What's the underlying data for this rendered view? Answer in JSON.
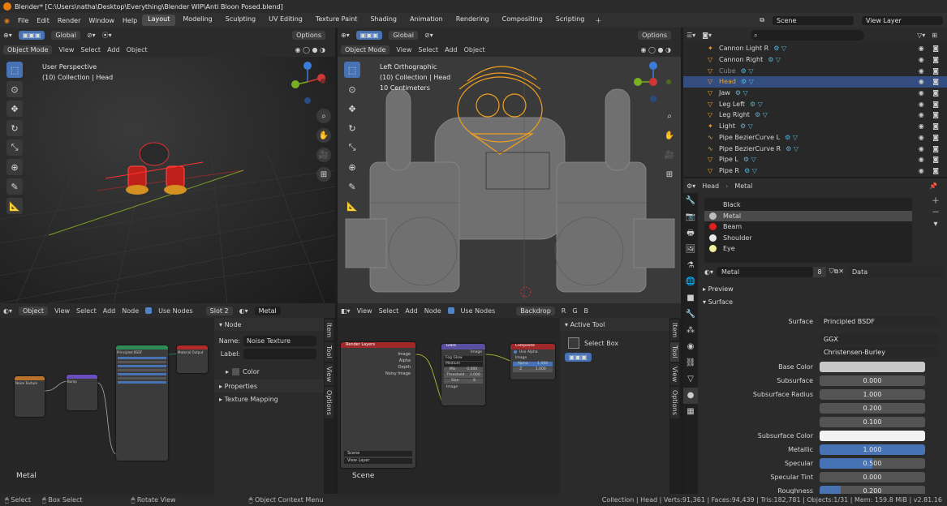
{
  "app": {
    "title": "Blender* [C:\\Users\\natha\\Desktop\\Everything\\Blender WIP\\Anti Bloon Posed.blend]"
  },
  "menu": [
    "File",
    "Edit",
    "Render",
    "Window",
    "Help"
  ],
  "workspaces": [
    "Layout",
    "Modeling",
    "Sculpting",
    "UV Editing",
    "Texture Paint",
    "Shading",
    "Animation",
    "Rendering",
    "Compositing",
    "Scripting"
  ],
  "scene": "Scene",
  "view_layer": "View Layer",
  "viewport_left": {
    "mode": "Object Mode",
    "menus": [
      "View",
      "Select",
      "Add",
      "Object"
    ],
    "orientation": "Global",
    "options": "Options",
    "overlay": [
      "User Perspective",
      "(10) Collection | Head"
    ]
  },
  "viewport_right": {
    "mode": "Object Mode",
    "menus": [
      "View",
      "Select",
      "Add",
      "Object"
    ],
    "orientation": "Global",
    "options": "Options",
    "overlay": [
      "Left Orthographic",
      "(10) Collection | Head",
      "10 Centimeters"
    ]
  },
  "outliner": {
    "items": [
      {
        "name": "Cannon Light R",
        "icon": "light"
      },
      {
        "name": "Cannon Right",
        "icon": "mesh"
      },
      {
        "name": "Cube",
        "icon": "mesh"
      },
      {
        "name": "Head",
        "icon": "mesh",
        "selected": true
      },
      {
        "name": "Jaw",
        "icon": "mesh"
      },
      {
        "name": "Leg Left",
        "icon": "mesh"
      },
      {
        "name": "Leg Right",
        "icon": "mesh"
      },
      {
        "name": "Light",
        "icon": "light"
      },
      {
        "name": "Pipe BezierCurve L",
        "icon": "curve"
      },
      {
        "name": "Pipe BezierCurve R",
        "icon": "curve"
      },
      {
        "name": "Pipe L",
        "icon": "mesh"
      },
      {
        "name": "Pipe R",
        "icon": "mesh"
      }
    ]
  },
  "properties": {
    "object": "Head",
    "material_slot": "Metal",
    "materials": [
      {
        "name": "Black",
        "color": "#222222"
      },
      {
        "name": "Metal",
        "color": "#bbbbbb"
      },
      {
        "name": "Beam",
        "color": "#e02020"
      },
      {
        "name": "Shoulder",
        "color": "#e8e8e8"
      },
      {
        "name": "Eye",
        "color": "#f0f0a0"
      }
    ],
    "material_name": "Metal",
    "users": "8",
    "data": "Data",
    "sections": {
      "preview": "Preview",
      "surface": "Surface"
    },
    "surface": {
      "label": "Surface",
      "value": "Principled BSDF",
      "distribution": "GGX",
      "sss_method": "Christensen-Burley"
    },
    "fields": [
      {
        "label": "Base Color",
        "value": "",
        "type": "color",
        "color": "#c8c8c8"
      },
      {
        "label": "Subsurface",
        "value": "0.000",
        "type": "num"
      },
      {
        "label": "Subsurface Radius",
        "value": "1.000",
        "type": "num"
      },
      {
        "label": "",
        "value": "0.200",
        "type": "num"
      },
      {
        "label": "",
        "value": "0.100",
        "type": "num"
      },
      {
        "label": "Subsurface Color",
        "value": "",
        "type": "color",
        "color": "#f2f2f2"
      },
      {
        "label": "Metallic",
        "value": "1.000",
        "type": "bar",
        "fill": 1.0
      },
      {
        "label": "Specular",
        "value": "0.500",
        "type": "bar",
        "fill": 0.5
      },
      {
        "label": "Specular Tint",
        "value": "0.000",
        "type": "num"
      },
      {
        "label": "Roughness",
        "value": "0.200",
        "type": "bar",
        "fill": 0.2
      }
    ]
  },
  "shader_editor": {
    "object": "Object",
    "menus": [
      "View",
      "Select",
      "Add",
      "Node"
    ],
    "use_nodes": "Use Nodes",
    "slot": "Slot 2",
    "material": "Metal",
    "label": "Metal",
    "nodes": {
      "noise": "Noise Texture",
      "bump": "Bump",
      "bsdf": "Principled BSDF",
      "output": "Material Output"
    }
  },
  "node_panel": {
    "title": "Node",
    "name_label": "Name:",
    "name": "Noise Texture",
    "label_label": "Label:",
    "color": "Color",
    "properties": "Properties",
    "texture_mapping": "Texture Mapping",
    "tabs": [
      "Item",
      "Tool",
      "View",
      "Options"
    ]
  },
  "compositor": {
    "menus": [
      "View",
      "Select",
      "Add",
      "Node"
    ],
    "use_nodes": "Use Nodes",
    "backdrop": "Backdrop",
    "channels": [
      "R",
      "G",
      "B"
    ],
    "scene_label": "Scene",
    "nodes": {
      "render_layers": {
        "title": "Render Layers",
        "outputs": [
          "Image",
          "Alpha",
          "Depth",
          "Noisy Image"
        ],
        "scene": "Scene",
        "view_layer": "View Layer"
      },
      "glare": {
        "title": "Glare",
        "output": "Image",
        "type": "Fog Glow",
        "quality": "Medium",
        "mix_label": "Mix",
        "mix": "0.000",
        "threshold_label": "Threshold",
        "threshold": "1.000",
        "size_label": "Size",
        "size": "8",
        "input": "Image"
      },
      "composite": {
        "title": "Composite",
        "use_alpha": "Use Alpha",
        "inputs": [
          "Image",
          "Alpha",
          "Z"
        ],
        "alpha": "1.000",
        "z": "1.000"
      }
    }
  },
  "tool_panel": {
    "title": "Active Tool",
    "tool": "Select Box",
    "tabs": [
      "Item",
      "Tool",
      "View",
      "Options"
    ]
  },
  "statusbar": {
    "left": [
      "Select",
      "Box Select",
      "Rotate View",
      "Object Context Menu"
    ],
    "right": "Collection | Head | Verts:91,361 | Faces:94,439 | Tris:182,781 | Objects:1/31 | Mem: 159.8 MiB | v2.81.16"
  }
}
